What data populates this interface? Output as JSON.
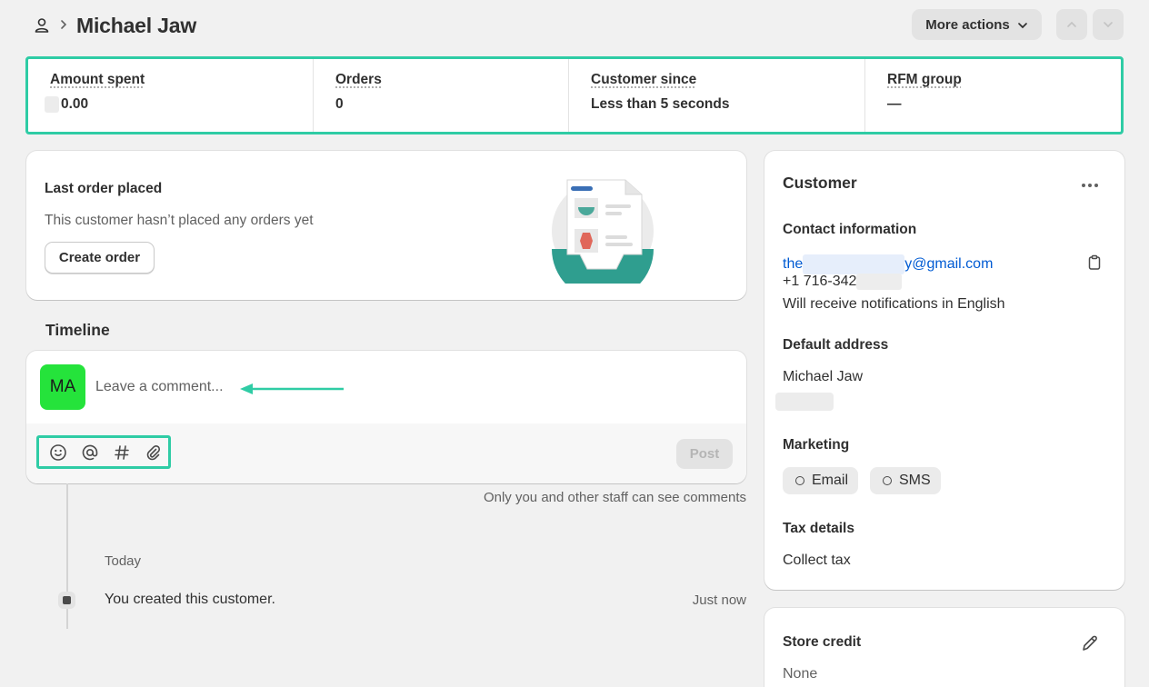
{
  "header": {
    "title": "Michael Jaw",
    "more_actions_label": "More actions"
  },
  "metrics": [
    {
      "label": "Amount spent",
      "value": "0.00"
    },
    {
      "label": "Orders",
      "value": "0"
    },
    {
      "label": "Customer since",
      "value": "Less than 5 seconds"
    },
    {
      "label": "RFM group",
      "value": "—"
    }
  ],
  "last_order": {
    "title": "Last order placed",
    "text": "This customer hasn’t placed any orders yet",
    "button": "Create order"
  },
  "timeline": {
    "title": "Timeline",
    "avatar_initials": "MA",
    "comment_placeholder": "Leave a comment...",
    "post_label": "Post",
    "staff_note": "Only you and other staff can see comments",
    "day_label": "Today",
    "event_text": "You created this customer.",
    "event_time": "Just now",
    "tools": [
      "emoji-icon",
      "mention-icon",
      "hashtag-icon",
      "attachment-icon"
    ]
  },
  "customer": {
    "title": "Customer",
    "contact_title": "Contact information",
    "email_prefix": "the",
    "email_suffix": "y@gmail.com",
    "phone_prefix": "+1 716-342",
    "language_note": "Will receive notifications in English",
    "address_title": "Default address",
    "address_name": "Michael Jaw",
    "marketing_title": "Marketing",
    "marketing_email": "Email",
    "marketing_sms": "SMS",
    "tax_title": "Tax details",
    "tax_value": "Collect tax"
  },
  "store_credit": {
    "title": "Store credit",
    "value": "None"
  },
  "colors": {
    "accent_highlight": "#2fcca5",
    "avatar": "#25e33b",
    "link": "#005bd3",
    "background": "#f1f1f1"
  }
}
